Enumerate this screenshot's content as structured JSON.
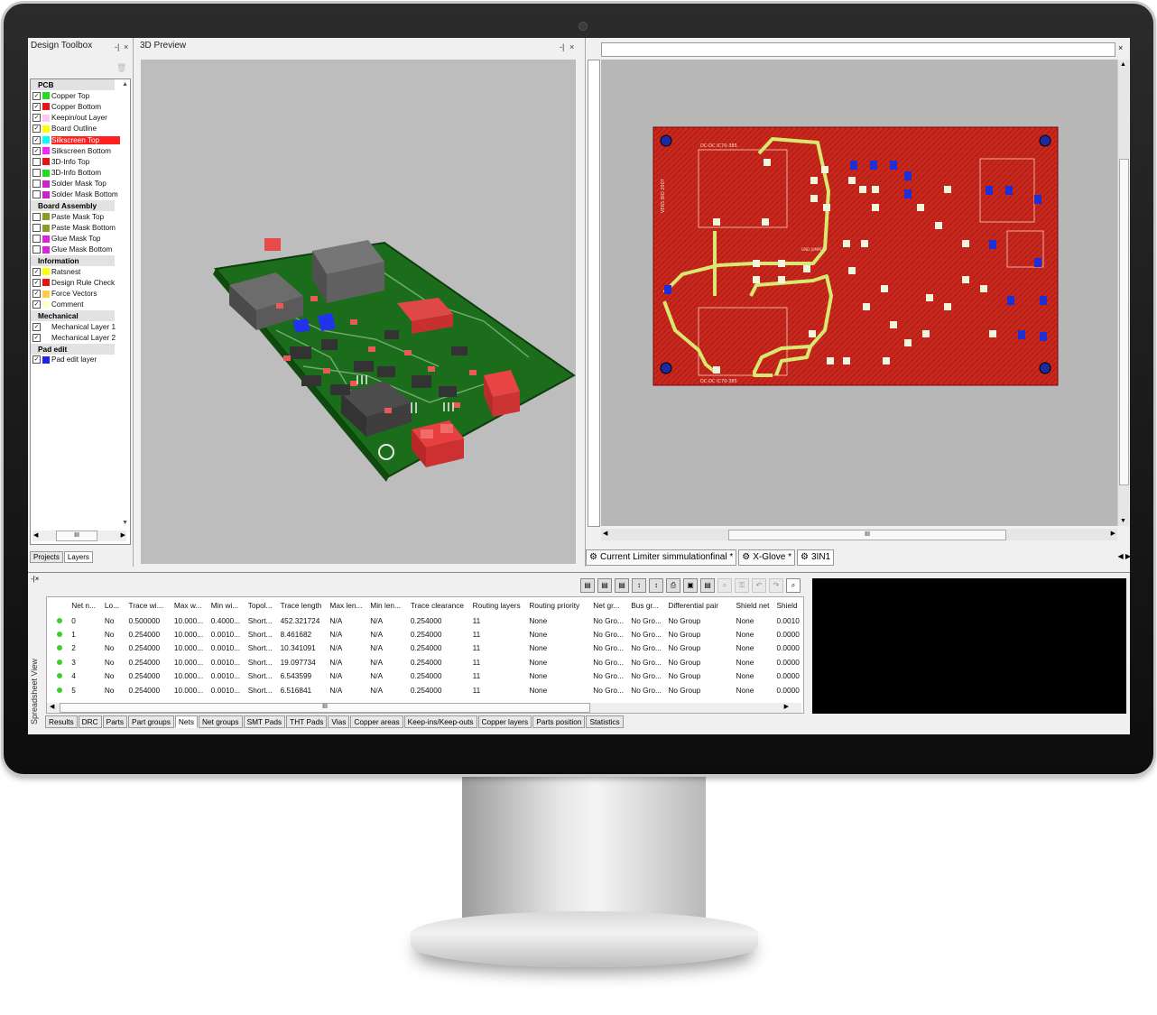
{
  "toolbox": {
    "title": "Design Toolbox",
    "groups": [
      {
        "name": "PCB",
        "items": [
          {
            "label": "Copper Top",
            "checked": true,
            "color": "#22dd22"
          },
          {
            "label": "Copper Bottom",
            "checked": true,
            "color": "#ee1111"
          },
          {
            "label": "Keepin/out Layer",
            "checked": true,
            "color": "#ffc8f0"
          },
          {
            "label": "Board Outline",
            "checked": true,
            "color": "#ffff00"
          },
          {
            "label": "Silkscreen Top",
            "checked": true,
            "color": "#00ffff",
            "highlighted": true
          },
          {
            "label": "Silkscreen Bottom",
            "checked": true,
            "color": "#ff22ff"
          },
          {
            "label": "3D-Info Top",
            "checked": false,
            "color": "#ee1111"
          },
          {
            "label": "3D-Info Bottom",
            "checked": false,
            "color": "#22dd22"
          },
          {
            "label": "Solder Mask Top",
            "checked": false,
            "color": "#cc22cc"
          },
          {
            "label": "Solder Mask Bottom",
            "checked": false,
            "color": "#cc22cc"
          }
        ]
      },
      {
        "name": "Board Assembly",
        "items": [
          {
            "label": "Paste Mask Top",
            "checked": false,
            "color": "#88a022"
          },
          {
            "label": "Paste Mask Bottom",
            "checked": false,
            "color": "#88a022"
          },
          {
            "label": "Glue Mask Top",
            "checked": false,
            "color": "#dd22dd"
          },
          {
            "label": "Glue Mask Bottom",
            "checked": false,
            "color": "#dd22dd"
          }
        ]
      },
      {
        "name": "Information",
        "items": [
          {
            "label": "Ratsnest",
            "checked": true,
            "color": "#ffff00"
          },
          {
            "label": "Design Rule Check",
            "checked": true,
            "color": "#ee1111"
          },
          {
            "label": "Force Vectors",
            "checked": true,
            "color": "#ffcc44"
          },
          {
            "label": "Comment",
            "checked": true,
            "color": "#ffffcc"
          }
        ]
      },
      {
        "name": "Mechanical",
        "items": [
          {
            "label": "Mechanical Layer 1",
            "checked": true,
            "color": null
          },
          {
            "label": "Mechanical Layer 2",
            "checked": true,
            "color": null
          }
        ]
      },
      {
        "name": "Pad edit",
        "items": [
          {
            "label": "Pad edit layer",
            "checked": true,
            "color": "#2222ee"
          }
        ]
      }
    ],
    "scroll_glyph": "III",
    "tabs": [
      "Projects",
      "Layers"
    ]
  },
  "preview": {
    "title": "3D Preview"
  },
  "editor": {
    "scroll_glyph": "III",
    "doc_tabs": [
      "Current Limiter simmulationfinal *",
      "X-Glove *",
      "3IN1"
    ],
    "board_labels": [
      "DC-DC IC70-385",
      "DC-DC IC70-385",
      "VERS BIO 2007",
      "GND JUMPER"
    ]
  },
  "spreadsheet": {
    "side_label": "Spreadsheet View",
    "columns": [
      "",
      "Net n...",
      "Lo...",
      "Trace wi...",
      "Max w...",
      "Min wi...",
      "Topol...",
      "Trace length",
      "Max len...",
      "Min len...",
      "Trace clearance",
      "Routing layers",
      "Routing priority",
      "Net gr...",
      "Bus gr...",
      "Differential pair",
      "Shield net",
      "Shield"
    ],
    "rows": [
      [
        "0",
        "No",
        "0.500000",
        "10.000...",
        "0.4000...",
        "Short...",
        "452.321724",
        "N/A",
        "N/A",
        "0.254000",
        "11",
        "None",
        "No Gro...",
        "No Gro...",
        "No Group",
        "None",
        "0.0010"
      ],
      [
        "1",
        "No",
        "0.254000",
        "10.000...",
        "0.0010...",
        "Short...",
        "8.461682",
        "N/A",
        "N/A",
        "0.254000",
        "11",
        "None",
        "No Gro...",
        "No Gro...",
        "No Group",
        "None",
        "0.0000"
      ],
      [
        "2",
        "No",
        "0.254000",
        "10.000...",
        "0.0010...",
        "Short...",
        "10.341091",
        "N/A",
        "N/A",
        "0.254000",
        "11",
        "None",
        "No Gro...",
        "No Gro...",
        "No Group",
        "None",
        "0.0000"
      ],
      [
        "3",
        "No",
        "0.254000",
        "10.000...",
        "0.0010...",
        "Short...",
        "19.097734",
        "N/A",
        "N/A",
        "0.254000",
        "11",
        "None",
        "No Gro...",
        "No Gro...",
        "No Group",
        "None",
        "0.0000"
      ],
      [
        "4",
        "No",
        "0.254000",
        "10.000...",
        "0.0010...",
        "Short...",
        "6.543599",
        "N/A",
        "N/A",
        "0.254000",
        "11",
        "None",
        "No Gro...",
        "No Gro...",
        "No Group",
        "None",
        "0.0000"
      ],
      [
        "5",
        "No",
        "0.254000",
        "10.000...",
        "0.0010...",
        "Short...",
        "6.516841",
        "N/A",
        "N/A",
        "0.254000",
        "11",
        "None",
        "No Gro...",
        "No Gro...",
        "No Group",
        "None",
        "0.0000"
      ]
    ],
    "scroll_glyph": "III",
    "tabs": [
      "Results",
      "DRC",
      "Parts",
      "Part groups",
      "Nets",
      "Net groups",
      "SMT Pads",
      "THT Pads",
      "Vias",
      "Copper areas",
      "Keep-ins/Keep-outs",
      "Copper layers",
      "Parts position",
      "Statistics"
    ],
    "active_tab": "Nets"
  }
}
